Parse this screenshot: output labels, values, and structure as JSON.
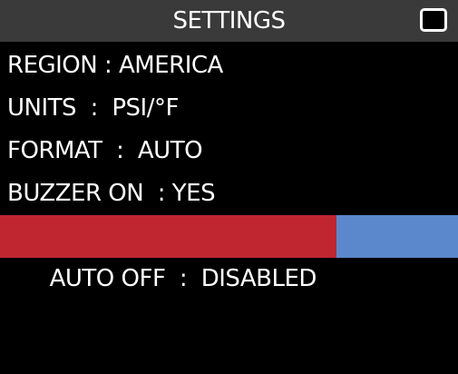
{
  "header": {
    "title": "SETTINGS",
    "icon": "battery-icon"
  },
  "menu": {
    "items": [
      {
        "label": "REGION : AMERICA"
      },
      {
        "label": "UNITS  :  PSI/°F"
      },
      {
        "label": "FORMAT  :  AUTO"
      },
      {
        "label": "BUZZER ON  : YES"
      },
      {
        "label": "AUTO OFF  :  DISABLED",
        "selected": true
      }
    ]
  },
  "colors": {
    "background": "#000000",
    "header_background": "#3a3a3a",
    "selected_row": "#bf2630",
    "selected_accent": "#5b88cc",
    "text": "#ffffff"
  }
}
